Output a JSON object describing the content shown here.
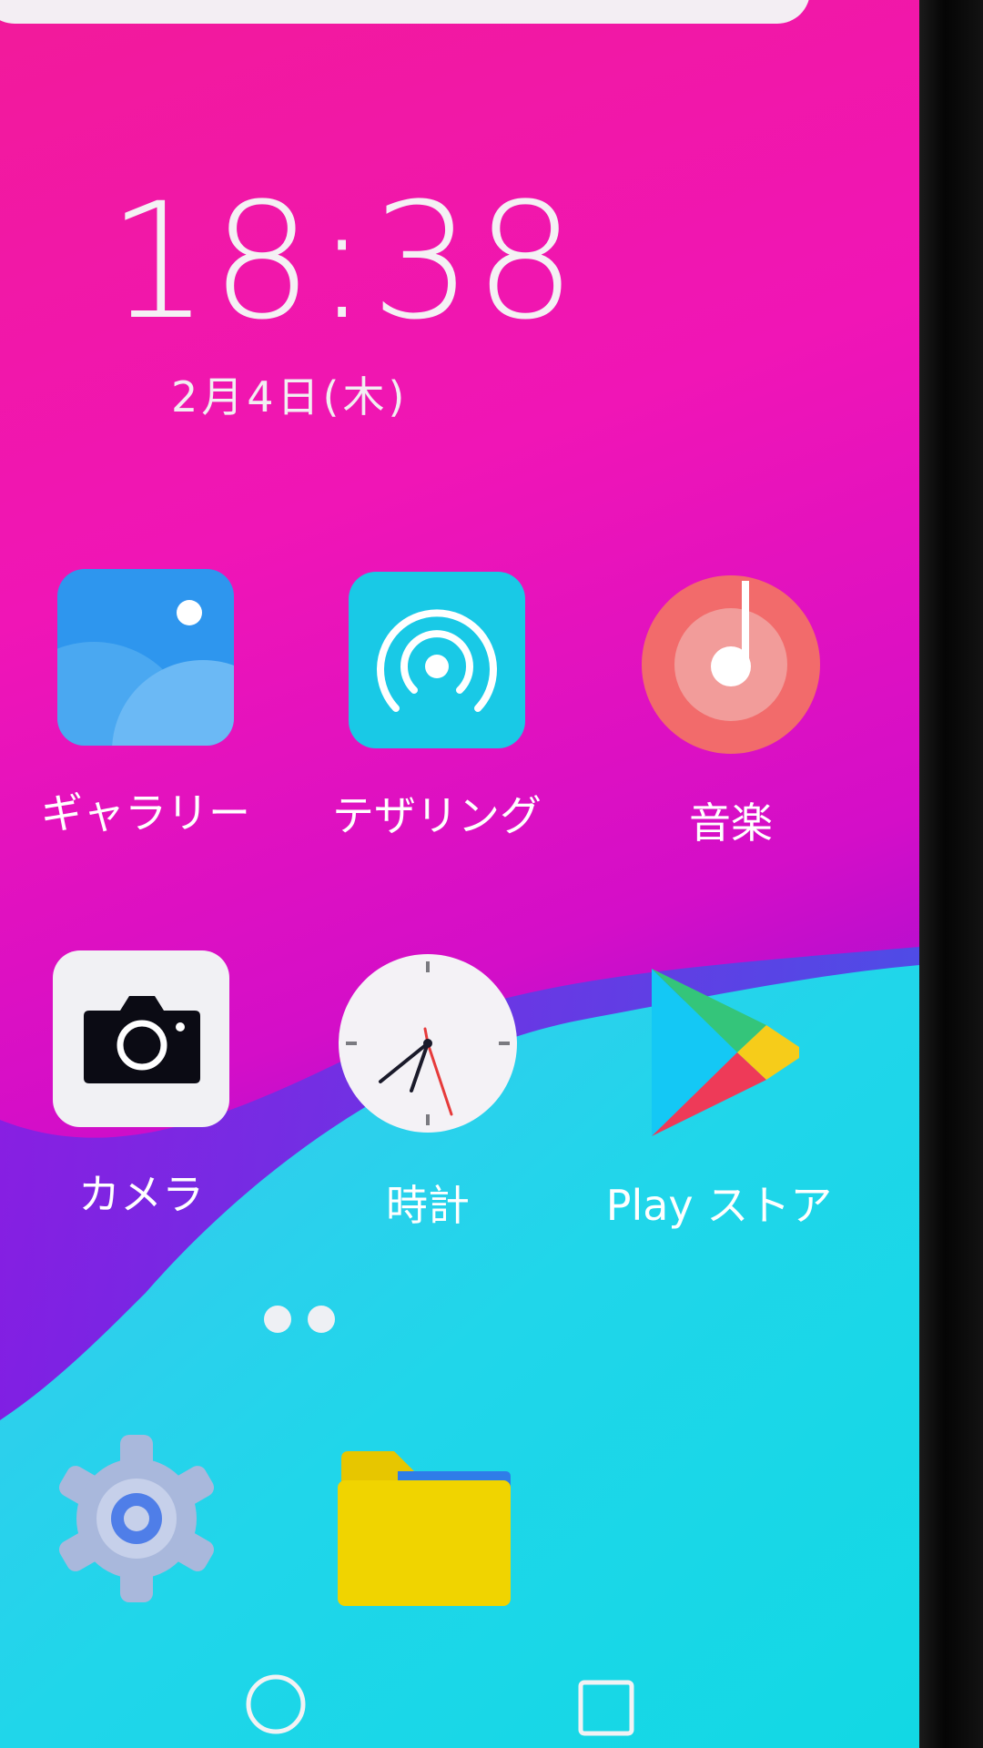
{
  "clock": {
    "time": "18:38",
    "date": "2月4日(木)"
  },
  "apps": [
    {
      "label": "ギャラリー",
      "icon": "gallery-icon"
    },
    {
      "label": "テザリング",
      "icon": "tethering-icon"
    },
    {
      "label": "音楽",
      "icon": "music-icon"
    },
    {
      "label": "カメラ",
      "icon": "camera-icon"
    },
    {
      "label": "時計",
      "icon": "clock-icon"
    },
    {
      "label": "Play ストア",
      "icon": "play-store-icon"
    }
  ],
  "dock": [
    {
      "icon": "settings-icon"
    },
    {
      "icon": "files-folder-icon"
    }
  ],
  "pager": {
    "pages": 2,
    "current": 1
  },
  "nav": [
    {
      "icon": "home-circle-icon"
    },
    {
      "icon": "recents-square-icon"
    }
  ],
  "colors": {
    "wallpaper_pink": "#f015b6",
    "wallpaper_cyan": "#1fd4ea",
    "gallery_blue": "#2e96ee",
    "tether_cyan": "#19c9e6",
    "music_red": "#f26b6b",
    "folder_yellow": "#f0d400"
  }
}
